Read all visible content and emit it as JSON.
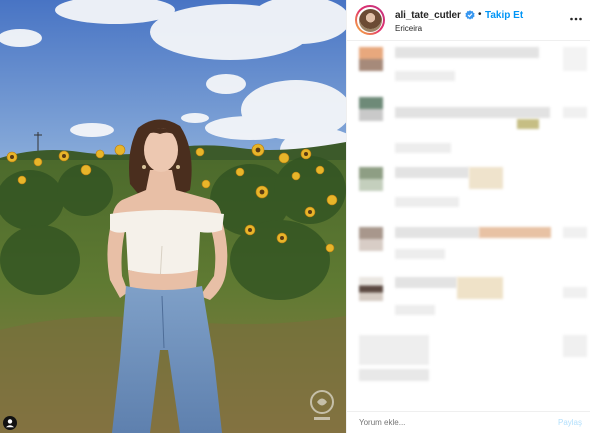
{
  "header": {
    "username": "ali_tate_cutler",
    "separator": "•",
    "follow_label": "Takip Et",
    "location": "Ericeira"
  },
  "footer": {
    "comment_placeholder": "Yorum ekle...",
    "share_label": "Paylaş"
  },
  "icons": {
    "verified": "verified-badge-icon",
    "more": "more-options-icon",
    "user_tag": "user-tag-icon"
  },
  "colors": {
    "accent": "#0095f6",
    "share_disabled": "#b2dffc",
    "text": "#262626",
    "muted": "#8e8e8e"
  }
}
